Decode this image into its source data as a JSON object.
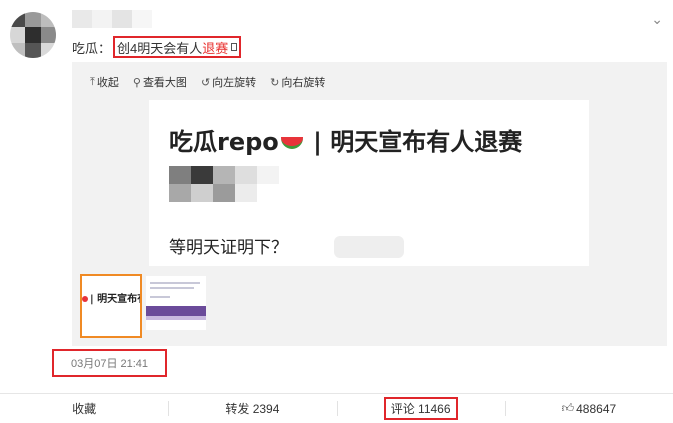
{
  "post": {
    "author": "吃瓜：",
    "text_prefix": "创4明天会有人",
    "text_red": "退赛"
  },
  "media": {
    "toolbar": {
      "collapse": "收起",
      "view_large": "查看大图",
      "rotate_left": "向左旋转",
      "rotate_right": "向右旋转"
    },
    "card": {
      "title_left": "吃瓜repo",
      "title_right": " | 明天宣布有人退赛",
      "subtitle": "等明天证明下？"
    },
    "thumb1_text": "| 明天宣布有"
  },
  "timestamp": "03月07日 21:41",
  "footer": {
    "favorite": "收藏",
    "repost": "转发 2394",
    "comment": "评论 11466",
    "like": "488647"
  },
  "icons": {
    "collapse": "arrow-up-icon",
    "view_large": "magnifier-icon",
    "rotate_left": "rotate-left-icon",
    "rotate_right": "rotate-right-icon",
    "menu": "chevron-down-icon",
    "like": "thumbs-up-icon"
  }
}
